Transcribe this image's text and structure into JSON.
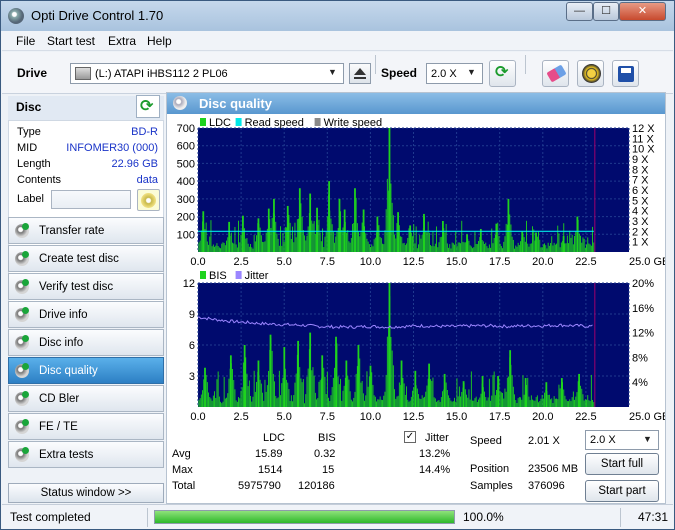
{
  "window": {
    "title": "Opti Drive Control 1.70",
    "min_label": "—",
    "max_label": "☐",
    "close_label": "✕"
  },
  "menu": [
    "File",
    "Start test",
    "Extra",
    "Help"
  ],
  "toolbar": {
    "drive_label": "Drive",
    "drive_value": "(L:)   ATAPI iHBS112   2 PL06",
    "speed_label": "Speed",
    "speed_value": "2.0 X"
  },
  "disc": {
    "header": "Disc",
    "type_label": "Type",
    "type_value": "BD-R",
    "mid_label": "MID",
    "mid_value": "INFOMER30 (000)",
    "length_label": "Length",
    "length_value": "22.96 GB",
    "contents_label": "Contents",
    "contents_value": "data",
    "label_label": "Label",
    "label_value": ""
  },
  "nav": [
    {
      "label": "Transfer rate",
      "active": false
    },
    {
      "label": "Create test disc",
      "active": false
    },
    {
      "label": "Verify test disc",
      "active": false
    },
    {
      "label": "Drive info",
      "active": false
    },
    {
      "label": "Disc info",
      "active": false
    },
    {
      "label": "Disc quality",
      "active": true
    },
    {
      "label": "CD Bler",
      "active": false
    },
    {
      "label": "FE / TE",
      "active": false
    },
    {
      "label": "Extra tests",
      "active": false
    }
  ],
  "status_window_label": "Status window >>",
  "panel_title": "Disc quality",
  "chart_data": [
    {
      "type": "bar",
      "legend": [
        "LDC",
        "Read speed",
        "Write speed"
      ],
      "legend_placement": "top-left",
      "x_ticks": [
        "0.0",
        "2.5",
        "5.0",
        "7.5",
        "10.0",
        "12.5",
        "15.0",
        "17.5",
        "20.0",
        "22.5",
        "25.0 GB"
      ],
      "xlim": [
        0,
        25
      ],
      "y_ticks": [
        "100",
        "200",
        "300",
        "400",
        "500",
        "600",
        "700"
      ],
      "ylim": [
        0,
        700
      ],
      "y2_ticks": [
        "1 X",
        "2 X",
        "3 X",
        "4 X",
        "5 X",
        "6 X",
        "7 X",
        "8 X",
        "9 X",
        "10 X",
        "11 X",
        "12 X"
      ],
      "y2lim": [
        0,
        12
      ],
      "grid": true,
      "data_end": 22.96,
      "ldc_peaks": [
        {
          "x": 0.3,
          "y": 230
        },
        {
          "x": 1.8,
          "y": 170
        },
        {
          "x": 2.6,
          "y": 205
        },
        {
          "x": 3.5,
          "y": 190
        },
        {
          "x": 4.1,
          "y": 245
        },
        {
          "x": 4.4,
          "y": 300
        },
        {
          "x": 5.2,
          "y": 260
        },
        {
          "x": 5.9,
          "y": 360
        },
        {
          "x": 6.5,
          "y": 330
        },
        {
          "x": 6.9,
          "y": 250
        },
        {
          "x": 7.6,
          "y": 400
        },
        {
          "x": 8.2,
          "y": 300
        },
        {
          "x": 8.5,
          "y": 240
        },
        {
          "x": 9.1,
          "y": 360
        },
        {
          "x": 9.6,
          "y": 240
        },
        {
          "x": 10.4,
          "y": 200
        },
        {
          "x": 11.1,
          "y": 700
        },
        {
          "x": 11.6,
          "y": 225
        },
        {
          "x": 12.3,
          "y": 150
        },
        {
          "x": 13.1,
          "y": 215
        },
        {
          "x": 14.2,
          "y": 175
        },
        {
          "x": 15.6,
          "y": 100
        },
        {
          "x": 16.4,
          "y": 130
        },
        {
          "x": 17.3,
          "y": 160
        },
        {
          "x": 18.0,
          "y": 300
        },
        {
          "x": 18.8,
          "y": 115
        },
        {
          "x": 19.6,
          "y": 110
        },
        {
          "x": 21.2,
          "y": 90
        },
        {
          "x": 22.0,
          "y": 200
        }
      ],
      "ldc_baseline": 45,
      "read_speed_x": 2.0
    },
    {
      "type": "bar",
      "legend": [
        "BIS",
        "Jitter"
      ],
      "legend_placement": "top-left",
      "x_ticks": [
        "0.0",
        "2.5",
        "5.0",
        "7.5",
        "10.0",
        "12.5",
        "15.0",
        "17.5",
        "20.0",
        "22.5",
        "25.0 GB"
      ],
      "xlim": [
        0,
        25
      ],
      "y_ticks": [
        "3",
        "6",
        "9",
        "12"
      ],
      "ylim": [
        0,
        12
      ],
      "y2_ticks": [
        "4%",
        "8%",
        "12%",
        "16%",
        "20%"
      ],
      "y2lim": [
        0,
        20
      ],
      "grid": true,
      "data_end": 22.96,
      "bis_peaks": [
        {
          "x": 0.4,
          "y": 3.8
        },
        {
          "x": 1.9,
          "y": 5.0
        },
        {
          "x": 2.7,
          "y": 6.0
        },
        {
          "x": 3.5,
          "y": 4.5
        },
        {
          "x": 4.2,
          "y": 7.0
        },
        {
          "x": 5.0,
          "y": 5.8
        },
        {
          "x": 5.8,
          "y": 6.4
        },
        {
          "x": 6.5,
          "y": 7.2
        },
        {
          "x": 7.2,
          "y": 5.0
        },
        {
          "x": 8.0,
          "y": 6.8
        },
        {
          "x": 8.6,
          "y": 4.5
        },
        {
          "x": 9.3,
          "y": 6.0
        },
        {
          "x": 10.0,
          "y": 4.0
        },
        {
          "x": 11.1,
          "y": 12.0
        },
        {
          "x": 11.8,
          "y": 4.5
        },
        {
          "x": 12.6,
          "y": 3.5
        },
        {
          "x": 13.4,
          "y": 4.2
        },
        {
          "x": 14.3,
          "y": 3.2
        },
        {
          "x": 15.4,
          "y": 2.5
        },
        {
          "x": 16.5,
          "y": 3.0
        },
        {
          "x": 17.4,
          "y": 3.0
        },
        {
          "x": 18.1,
          "y": 5.5
        },
        {
          "x": 19.0,
          "y": 2.8
        },
        {
          "x": 20.2,
          "y": 2.4
        },
        {
          "x": 21.1,
          "y": 2.8
        },
        {
          "x": 22.1,
          "y": 3.2
        }
      ],
      "bis_baseline": 0.9,
      "jitter": [
        {
          "x": 0.0,
          "y": 14.5
        },
        {
          "x": 1.0,
          "y": 14.1
        },
        {
          "x": 2.0,
          "y": 13.8
        },
        {
          "x": 3.0,
          "y": 13.6
        },
        {
          "x": 4.0,
          "y": 13.4
        },
        {
          "x": 5.0,
          "y": 13.3
        },
        {
          "x": 6.0,
          "y": 13.2
        },
        {
          "x": 7.0,
          "y": 13.0
        },
        {
          "x": 8.0,
          "y": 12.9
        },
        {
          "x": 9.0,
          "y": 12.9
        },
        {
          "x": 10.0,
          "y": 13.0
        },
        {
          "x": 11.0,
          "y": 12.9
        },
        {
          "x": 12.0,
          "y": 13.0
        },
        {
          "x": 13.0,
          "y": 13.1
        },
        {
          "x": 14.0,
          "y": 13.0
        },
        {
          "x": 15.0,
          "y": 13.0
        },
        {
          "x": 16.0,
          "y": 13.1
        },
        {
          "x": 17.0,
          "y": 13.1
        },
        {
          "x": 18.0,
          "y": 13.0
        },
        {
          "x": 19.0,
          "y": 13.1
        },
        {
          "x": 20.0,
          "y": 13.1
        },
        {
          "x": 21.0,
          "y": 13.2
        },
        {
          "x": 22.0,
          "y": 13.1
        },
        {
          "x": 22.96,
          "y": 13.0
        }
      ]
    }
  ],
  "stats": {
    "col_ldc": "LDC",
    "col_bis": "BIS",
    "col_jitter": "Jitter",
    "jitter_checked": "✓",
    "avg_label": "Avg",
    "avg_ldc": "15.89",
    "avg_bis": "0.32",
    "avg_jitter": "13.2%",
    "max_label": "Max",
    "max_ldc": "1514",
    "max_bis": "15",
    "max_jitter": "14.4%",
    "total_label": "Total",
    "total_ldc": "5975790",
    "total_bis": "120186",
    "speed_label": "Speed",
    "speed_value": "2.01 X",
    "position_label": "Position",
    "position_value": "23506 MB",
    "samples_label": "Samples",
    "samples_value": "376096",
    "speed_select_value": "2.0 X",
    "start_full_label": "Start full",
    "start_part_label": "Start part"
  },
  "status": {
    "text": "Test completed",
    "progress_fraction": 1.0,
    "progress_text": "100.0%",
    "elapsed": "47:31"
  },
  "colors": {
    "plot_bg": "#000a6e",
    "grid": "#1f3a8f",
    "ldc": "#1ed31e",
    "bis": "#1ed31e",
    "read_speed": "#00e8e8",
    "write_speed": "#8a8a8a",
    "jitter": "#9b86ff",
    "end_marker": "#a0006a"
  }
}
